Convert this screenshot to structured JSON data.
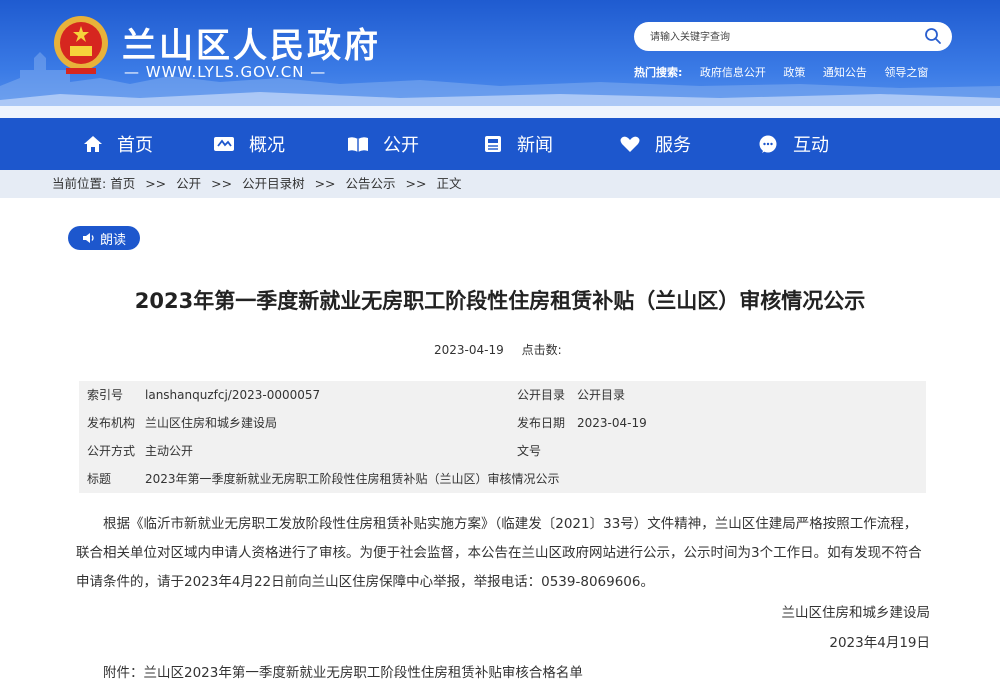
{
  "header": {
    "site_title": "兰山区人民政府",
    "site_url": "— WWW.LYLS.GOV.CN —",
    "search_placeholder": "请输入关键字查询",
    "hot_label": "热门搜索:",
    "hot_links": [
      "政府信息公开",
      "政策",
      "通知公告",
      "领导之窗"
    ]
  },
  "nav": {
    "items": [
      {
        "label": "首页",
        "icon": "home-icon"
      },
      {
        "label": "概况",
        "icon": "overview-icon"
      },
      {
        "label": "公开",
        "icon": "open-book-icon"
      },
      {
        "label": "新闻",
        "icon": "news-icon"
      },
      {
        "label": "服务",
        "icon": "service-heart-icon"
      },
      {
        "label": "互动",
        "icon": "chat-icon"
      }
    ]
  },
  "breadcrumb": {
    "prefix": "当前位置:",
    "items": [
      "首页",
      "公开",
      "公开目录树",
      "公告公示",
      "正文"
    ],
    "separator": ">>"
  },
  "article": {
    "read_label": "朗读",
    "title": "2023年第一季度新就业无房职工阶段性住房租赁补贴（兰山区）审核情况公示",
    "date": "2023-04-19",
    "clicks_label": "点击数:",
    "info": {
      "index_label": "索引号",
      "index_value": "lanshanquzfcj/2023-0000057",
      "catalog_label": "公开目录",
      "catalog_value": "公开目录",
      "org_label": "发布机构",
      "org_value": "兰山区住房和城乡建设局",
      "pubdate_label": "发布日期",
      "pubdate_value": "2023-04-19",
      "mode_label": "公开方式",
      "mode_value": "主动公开",
      "docno_label": "文号",
      "docno_value": "",
      "subject_label": "标题",
      "subject_value": "2023年第一季度新就业无房职工阶段性住房租赁补贴（兰山区）审核情况公示"
    },
    "body": "根据《临沂市新就业无房职工发放阶段性住房租赁补贴实施方案》（临建发〔2021〕33号）文件精神，兰山区住建局严格按照工作流程，联合相关单位对区域内申请人资格进行了审核。为便于社会监督，本公告在兰山区政府网站进行公示，公示时间为3个工作日。如有发现不符合申请条件的，请于2023年4月22日前向兰山区住房保障中心举报，举报电话：0539-8069606。",
    "signature_org": "兰山区住房和城乡建设局",
    "signature_date": "2023年4月19日",
    "attachment": "附件：兰山区2023年第一季度新就业无房职工阶段性住房租赁补贴审核合格名单"
  },
  "colors": {
    "primary_blue": "#1d57cd",
    "breadcrumb_bg": "#e6ecf5",
    "table_bg": "#f1f1f1"
  }
}
